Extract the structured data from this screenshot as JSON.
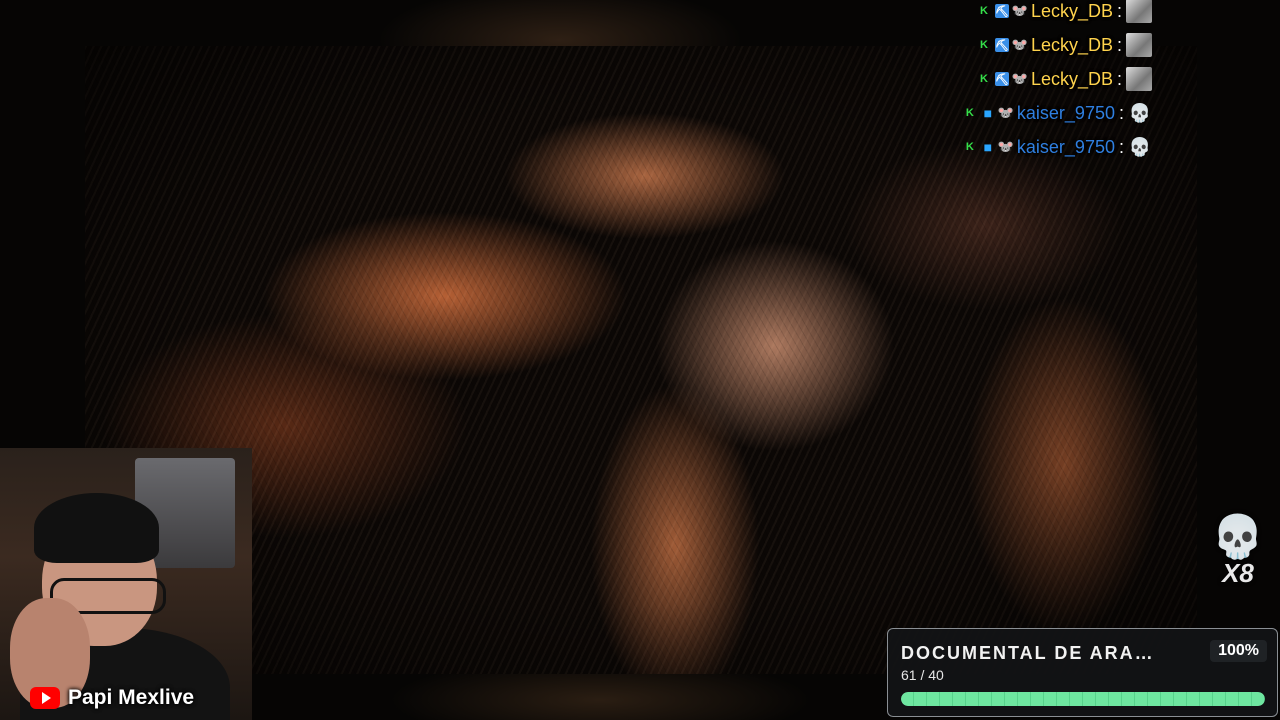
{
  "video": {
    "subject": "tarantula close-up"
  },
  "chat": {
    "messages": [
      {
        "badges": [
          "k-icon",
          "pickaxe-icon",
          "mouse-icon"
        ],
        "username": "Lecky_DB",
        "color": "#ffd34d",
        "separator": ":",
        "emote": "face-emote"
      },
      {
        "badges": [
          "k-icon",
          "pickaxe-icon",
          "mouse-icon"
        ],
        "username": "Lecky_DB",
        "color": "#ffd34d",
        "separator": ":",
        "emote": "face-emote"
      },
      {
        "badges": [
          "k-icon",
          "pickaxe-icon",
          "mouse-icon"
        ],
        "username": "Lecky_DB",
        "color": "#ffd34d",
        "separator": ":",
        "emote": "face-emote"
      },
      {
        "badges": [
          "k-icon",
          "cube-icon",
          "mouse-icon"
        ],
        "username": "kaiser_9750",
        "color": "#2f7fe0",
        "separator": ":",
        "emote": "skull-emote"
      },
      {
        "badges": [
          "k-icon",
          "cube-icon",
          "mouse-icon"
        ],
        "username": "kaiser_9750",
        "color": "#2f7fe0",
        "separator": ":",
        "emote": "skull-emote"
      }
    ]
  },
  "skull_counter": {
    "icon": "skull-icon",
    "multiplier": "X8"
  },
  "streamer": {
    "platform_icon": "youtube-icon",
    "name": "Papi Mexlive"
  },
  "progress_card": {
    "title": "DOCUMENTAL DE ARA…",
    "percent_text": "100%",
    "count_text": "61 / 40",
    "progress": 1.0,
    "fill_color": "#6ee6a0"
  }
}
